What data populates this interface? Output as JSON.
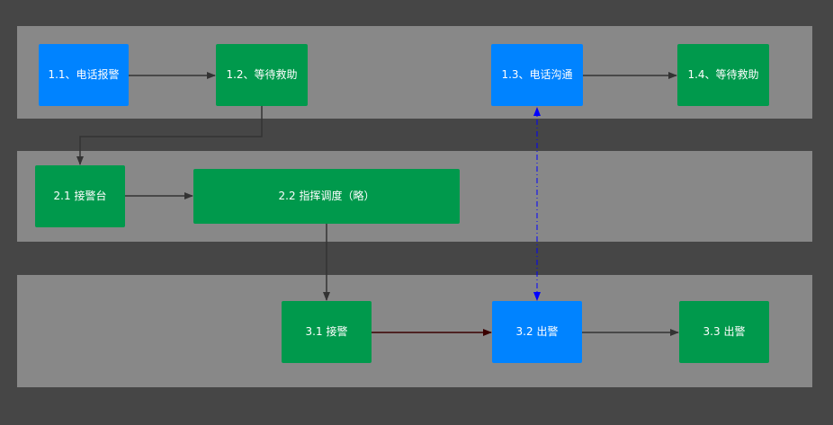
{
  "colors": {
    "background": "#464646",
    "lane": "#888888",
    "blue_node": "#0083ff",
    "green_node": "#00994c",
    "edge": "#333333",
    "edge_dark_red": "#3a0000",
    "edge_blue": "#0000ff"
  },
  "nodes": {
    "n11": {
      "label": "1.1、电话报警",
      "color": "blue"
    },
    "n12": {
      "label": "1.2、等待救助",
      "color": "green"
    },
    "n13": {
      "label": "1.3、电话沟通",
      "color": "blue"
    },
    "n14": {
      "label": "1.4、等待救助",
      "color": "green"
    },
    "n21": {
      "label": "2.1 接警台",
      "color": "green"
    },
    "n22": {
      "label": "2.2 指挥调度（略）",
      "color": "green"
    },
    "n31": {
      "label": "3.1 接警",
      "color": "green"
    },
    "n32": {
      "label": "3.2 出警",
      "color": "blue"
    },
    "n33": {
      "label": "3.3 出警",
      "color": "green"
    }
  },
  "edges": [
    {
      "from": "1.1、电话报警",
      "to": "1.2、等待救助",
      "style": "solid"
    },
    {
      "from": "1.2、等待救助",
      "to": "2.1 接警台",
      "style": "solid"
    },
    {
      "from": "1.3、电话沟通",
      "to": "1.4、等待救助",
      "style": "solid"
    },
    {
      "from": "2.1 接警台",
      "to": "2.2 指挥调度（略）",
      "style": "solid"
    },
    {
      "from": "2.2 指挥调度（略）",
      "to": "3.1 接警",
      "style": "solid"
    },
    {
      "from": "3.1 接警",
      "to": "3.2 出警",
      "style": "solid",
      "color": "dark-red"
    },
    {
      "from": "3.2 出警",
      "to": "3.3 出警",
      "style": "solid"
    },
    {
      "from": "1.3、电话沟通",
      "to": "3.2 出警",
      "style": "dash-dot",
      "bidirectional": true,
      "color": "blue"
    }
  ]
}
